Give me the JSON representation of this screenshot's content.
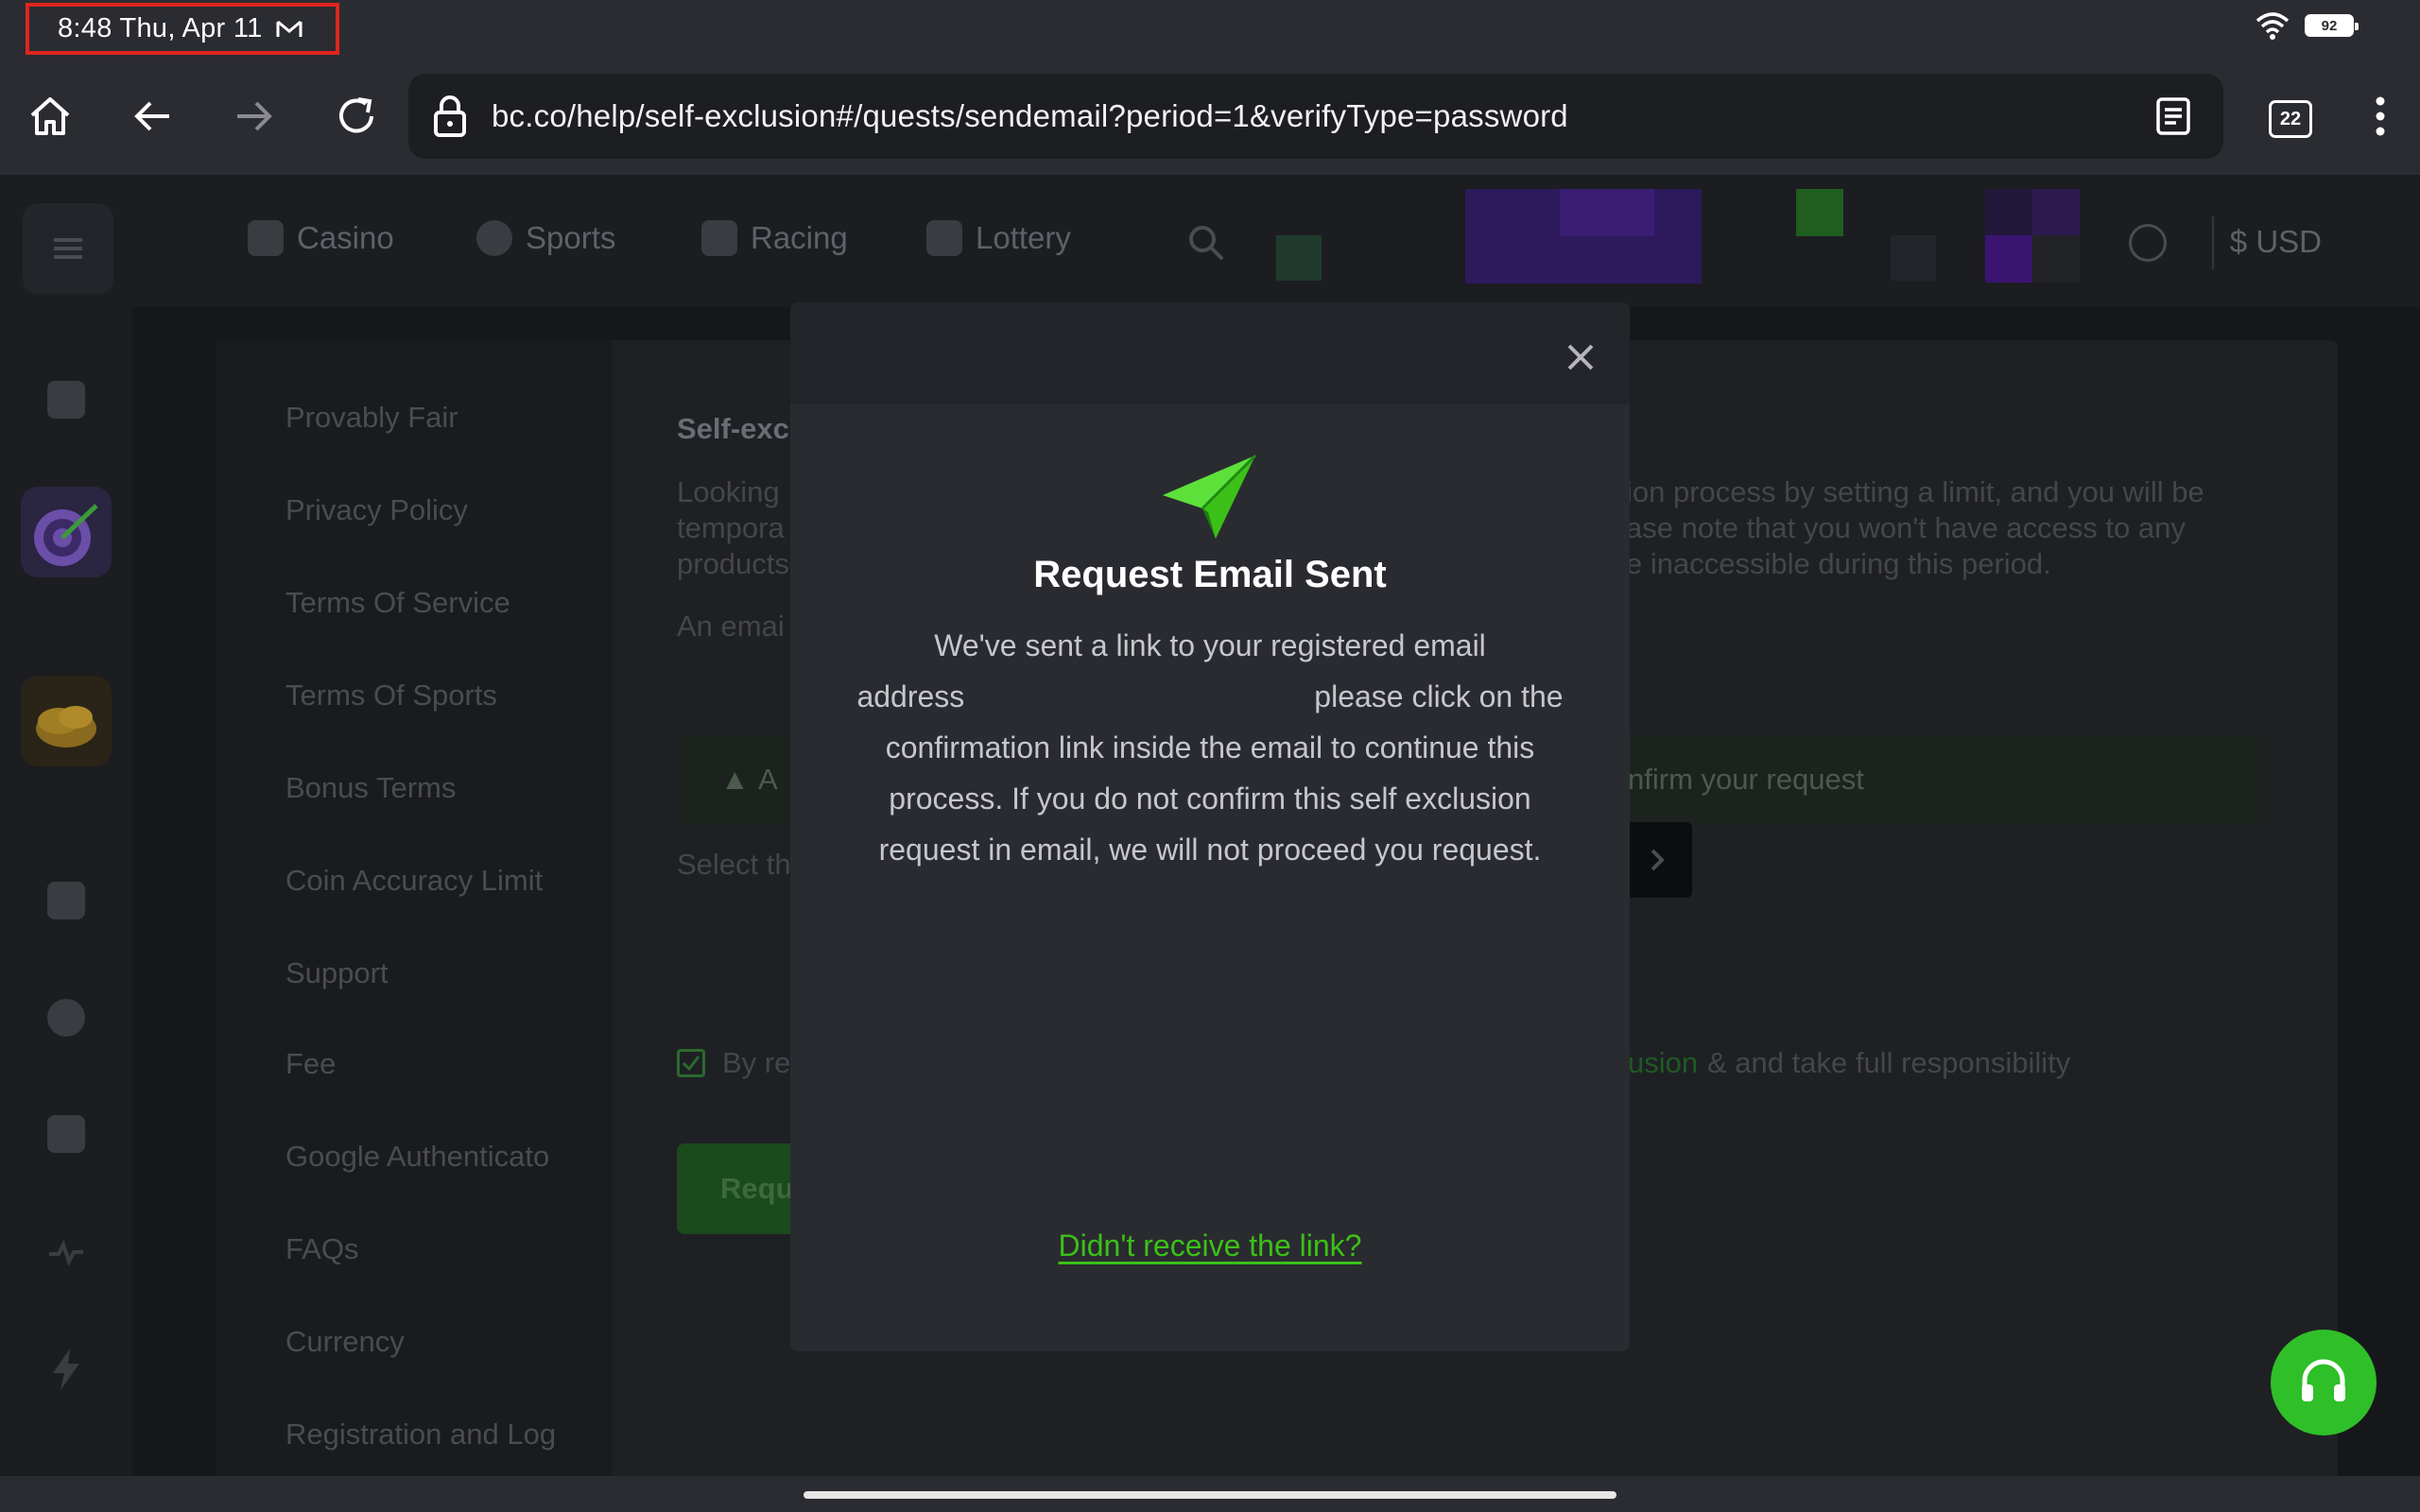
{
  "status_bar": {
    "time": "8:48 Thu, Apr 11",
    "battery": "92",
    "notification_icon": "gmail-icon"
  },
  "browser": {
    "url": "bc.co/help/self-exclusion#/quests/sendemail?period=1&verifyType=password",
    "tab_count": "22",
    "icons": [
      "home-icon",
      "back-icon",
      "forward-icon",
      "reload-icon",
      "lock-icon",
      "reader-mode-icon",
      "tabs-icon",
      "more-menu-icon"
    ]
  },
  "site_header": {
    "nav": [
      "Casino",
      "Sports",
      "Racing",
      "Lottery"
    ],
    "currency": "$ USD"
  },
  "side_menu": {
    "items": [
      "Provably Fair",
      "Privacy Policy",
      "Terms Of Service",
      "Terms Of Sports",
      "Bonus Terms",
      "Coin Accuracy Limit",
      "Support",
      "Fee",
      "Google Authenticato",
      "FAQs",
      "Currency",
      "Registration and Log"
    ]
  },
  "main": {
    "title": "Self-exc",
    "para_left_1": "Looking",
    "para_left_2": "tempora",
    "para_left_3": "products",
    "para_right_1": "ion process by setting a limit, and you will be",
    "para_right_2": "ase note that you won't have access to any",
    "para_right_3": "e inaccessible during this period.",
    "email_line": "An emai",
    "warn_left": "A",
    "warn_right": "nfirm your request",
    "select_label": "Select th",
    "agree_left": "By re",
    "agree_link": "usion",
    "agree_right": "& and take full responsibility",
    "request_button": "Requ"
  },
  "modal": {
    "title": "Request Email Sent",
    "body_line1": "We've sent a link to your registered email",
    "body_line2_a": "address",
    "body_line2_b": "please click on the",
    "body_line3": "confirmation link inside the email to continue this",
    "body_line4": "process. If you do not confirm this self exclusion",
    "body_line5": "request in email, we will not proceed you request.",
    "link": "Didn't receive the link?",
    "accent_color": "#3bc117"
  },
  "colors": {
    "brand_green": "#2fbf28",
    "highlight_red": "#e0251e"
  }
}
